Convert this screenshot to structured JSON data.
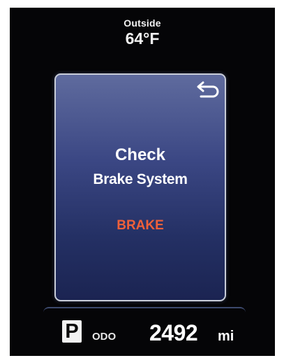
{
  "outside": {
    "label": "Outside",
    "temperature": "64°F"
  },
  "message": {
    "title": "Check",
    "subtitle": "Brake System",
    "warning": "BRAKE",
    "back_icon": "return-arrow-icon"
  },
  "status": {
    "gear": "P",
    "odo_label": "ODO",
    "odo_value": "2492",
    "odo_unit": "mi"
  },
  "colors": {
    "warning": "#f0603a",
    "panel": "#3b4784",
    "background": "#050507"
  }
}
